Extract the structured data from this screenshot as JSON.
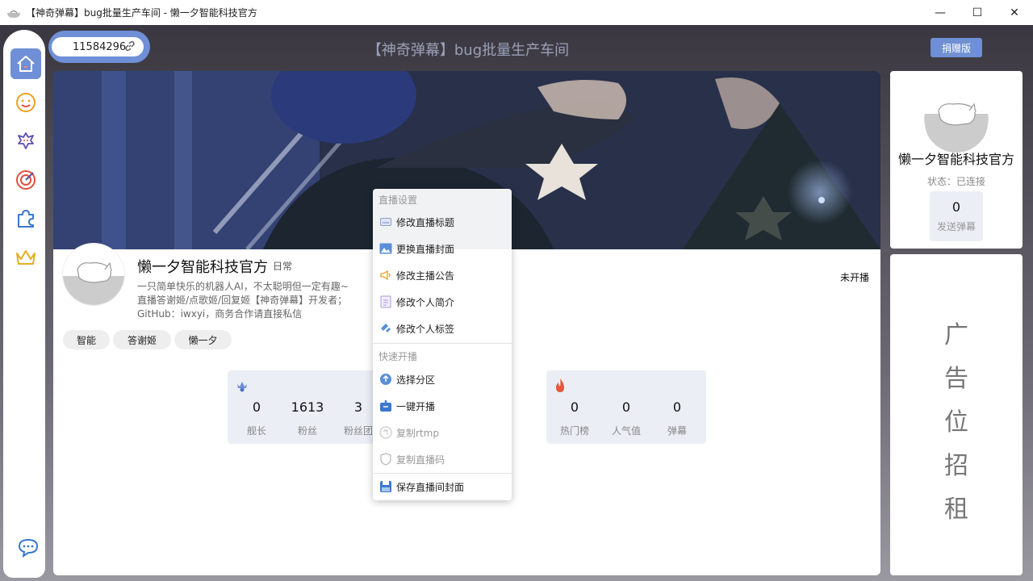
{
  "window": {
    "title": "【神奇弹幕】bug批量生产车间 - 懒一夕智能科技官方",
    "minimize": "—",
    "maximize": "☐",
    "close": "✕"
  },
  "header": {
    "room_id": "11584296",
    "app_title": "【神奇弹幕】bug批量生产车间",
    "donate_label": "捐赠版"
  },
  "sidebar": {
    "items": [
      {
        "icon": "home-icon",
        "active": true
      },
      {
        "icon": "smile-icon",
        "active": false
      },
      {
        "icon": "flower-icon",
        "active": false
      },
      {
        "icon": "target-icon",
        "active": false
      },
      {
        "icon": "puzzle-icon",
        "active": false
      },
      {
        "icon": "crown-icon",
        "active": false
      }
    ],
    "bottom_icon": "chat-icon"
  },
  "streamer": {
    "name": "懒一夕智能科技官方",
    "level": "日常",
    "bio": [
      "一只简单快乐的机器人AI，不太聪明但一定有趣~",
      "直播答谢姬/点歌姬/回复姬【神奇弹幕】开发者；",
      "GitHub：iwxyi，商务合作请直接私信"
    ],
    "live_status": "未开播",
    "tags": [
      "智能",
      "答谢姬",
      "懒一夕"
    ]
  },
  "stats_left": {
    "icon": "captain-icon",
    "cells": [
      {
        "value": "0",
        "label": "舰长"
      },
      {
        "value": "1613",
        "label": "粉丝"
      },
      {
        "value": "3",
        "label": "粉丝团"
      }
    ]
  },
  "stats_right": {
    "icon": "flame-icon",
    "cells": [
      {
        "value": "0",
        "label": "热门榜"
      },
      {
        "value": "0",
        "label": "人气值"
      },
      {
        "value": "0",
        "label": "弹幕"
      }
    ]
  },
  "profile": {
    "name": "懒一夕智能科技官方",
    "status": "状态：已连接",
    "danmu_count": "0",
    "danmu_label": "发送弹幕"
  },
  "ad": {
    "chars": [
      "广",
      "告",
      "位",
      "招",
      "租"
    ]
  },
  "context_menu": {
    "section1": "直播设置",
    "items1": [
      {
        "label": "修改直播标题",
        "icon": "keyboard-icon",
        "disabled": false
      },
      {
        "label": "更换直播封面",
        "icon": "image-icon",
        "disabled": false
      },
      {
        "label": "修改主播公告",
        "icon": "megaphone-icon",
        "disabled": false
      },
      {
        "label": "修改个人简介",
        "icon": "document-icon",
        "disabled": false
      },
      {
        "label": "修改个人标签",
        "icon": "tag-icon",
        "disabled": false
      }
    ],
    "section2": "快速开播",
    "items2": [
      {
        "label": "选择分区",
        "icon": "upload-icon",
        "disabled": false
      },
      {
        "label": "一键开播",
        "icon": "broadcast-icon",
        "disabled": false
      },
      {
        "label": "复制rtmp",
        "icon": "copy-icon",
        "disabled": true
      },
      {
        "label": "复制直播码",
        "icon": "shield-icon",
        "disabled": true
      }
    ],
    "save_item": {
      "label": "保存直播间封面",
      "icon": "save-icon",
      "disabled": false
    }
  },
  "colors": {
    "accent": "#6f8fd6",
    "stat_bg": "#ebeef5",
    "flame": "#e8543c"
  }
}
